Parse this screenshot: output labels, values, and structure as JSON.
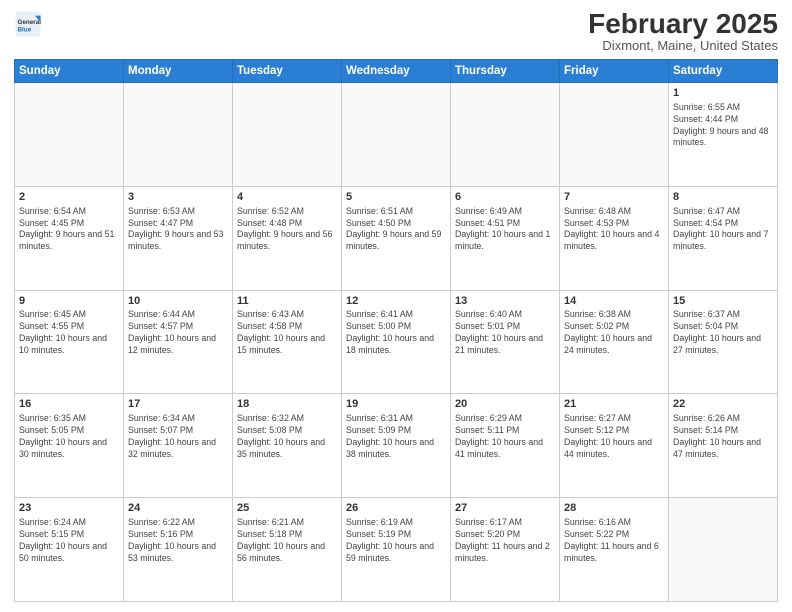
{
  "header": {
    "logo": {
      "general": "General",
      "blue": "Blue"
    },
    "title": "February 2025",
    "location": "Dixmont, Maine, United States"
  },
  "days_of_week": [
    "Sunday",
    "Monday",
    "Tuesday",
    "Wednesday",
    "Thursday",
    "Friday",
    "Saturday"
  ],
  "weeks": [
    [
      {
        "day": "",
        "info": ""
      },
      {
        "day": "",
        "info": ""
      },
      {
        "day": "",
        "info": ""
      },
      {
        "day": "",
        "info": ""
      },
      {
        "day": "",
        "info": ""
      },
      {
        "day": "",
        "info": ""
      },
      {
        "day": "1",
        "info": "Sunrise: 6:55 AM\nSunset: 4:44 PM\nDaylight: 9 hours and 48 minutes."
      }
    ],
    [
      {
        "day": "2",
        "info": "Sunrise: 6:54 AM\nSunset: 4:45 PM\nDaylight: 9 hours and 51 minutes."
      },
      {
        "day": "3",
        "info": "Sunrise: 6:53 AM\nSunset: 4:47 PM\nDaylight: 9 hours and 53 minutes."
      },
      {
        "day": "4",
        "info": "Sunrise: 6:52 AM\nSunset: 4:48 PM\nDaylight: 9 hours and 56 minutes."
      },
      {
        "day": "5",
        "info": "Sunrise: 6:51 AM\nSunset: 4:50 PM\nDaylight: 9 hours and 59 minutes."
      },
      {
        "day": "6",
        "info": "Sunrise: 6:49 AM\nSunset: 4:51 PM\nDaylight: 10 hours and 1 minute."
      },
      {
        "day": "7",
        "info": "Sunrise: 6:48 AM\nSunset: 4:53 PM\nDaylight: 10 hours and 4 minutes."
      },
      {
        "day": "8",
        "info": "Sunrise: 6:47 AM\nSunset: 4:54 PM\nDaylight: 10 hours and 7 minutes."
      }
    ],
    [
      {
        "day": "9",
        "info": "Sunrise: 6:45 AM\nSunset: 4:55 PM\nDaylight: 10 hours and 10 minutes."
      },
      {
        "day": "10",
        "info": "Sunrise: 6:44 AM\nSunset: 4:57 PM\nDaylight: 10 hours and 12 minutes."
      },
      {
        "day": "11",
        "info": "Sunrise: 6:43 AM\nSunset: 4:58 PM\nDaylight: 10 hours and 15 minutes."
      },
      {
        "day": "12",
        "info": "Sunrise: 6:41 AM\nSunset: 5:00 PM\nDaylight: 10 hours and 18 minutes."
      },
      {
        "day": "13",
        "info": "Sunrise: 6:40 AM\nSunset: 5:01 PM\nDaylight: 10 hours and 21 minutes."
      },
      {
        "day": "14",
        "info": "Sunrise: 6:38 AM\nSunset: 5:02 PM\nDaylight: 10 hours and 24 minutes."
      },
      {
        "day": "15",
        "info": "Sunrise: 6:37 AM\nSunset: 5:04 PM\nDaylight: 10 hours and 27 minutes."
      }
    ],
    [
      {
        "day": "16",
        "info": "Sunrise: 6:35 AM\nSunset: 5:05 PM\nDaylight: 10 hours and 30 minutes."
      },
      {
        "day": "17",
        "info": "Sunrise: 6:34 AM\nSunset: 5:07 PM\nDaylight: 10 hours and 32 minutes."
      },
      {
        "day": "18",
        "info": "Sunrise: 6:32 AM\nSunset: 5:08 PM\nDaylight: 10 hours and 35 minutes."
      },
      {
        "day": "19",
        "info": "Sunrise: 6:31 AM\nSunset: 5:09 PM\nDaylight: 10 hours and 38 minutes."
      },
      {
        "day": "20",
        "info": "Sunrise: 6:29 AM\nSunset: 5:11 PM\nDaylight: 10 hours and 41 minutes."
      },
      {
        "day": "21",
        "info": "Sunrise: 6:27 AM\nSunset: 5:12 PM\nDaylight: 10 hours and 44 minutes."
      },
      {
        "day": "22",
        "info": "Sunrise: 6:26 AM\nSunset: 5:14 PM\nDaylight: 10 hours and 47 minutes."
      }
    ],
    [
      {
        "day": "23",
        "info": "Sunrise: 6:24 AM\nSunset: 5:15 PM\nDaylight: 10 hours and 50 minutes."
      },
      {
        "day": "24",
        "info": "Sunrise: 6:22 AM\nSunset: 5:16 PM\nDaylight: 10 hours and 53 minutes."
      },
      {
        "day": "25",
        "info": "Sunrise: 6:21 AM\nSunset: 5:18 PM\nDaylight: 10 hours and 56 minutes."
      },
      {
        "day": "26",
        "info": "Sunrise: 6:19 AM\nSunset: 5:19 PM\nDaylight: 10 hours and 59 minutes."
      },
      {
        "day": "27",
        "info": "Sunrise: 6:17 AM\nSunset: 5:20 PM\nDaylight: 11 hours and 2 minutes."
      },
      {
        "day": "28",
        "info": "Sunrise: 6:16 AM\nSunset: 5:22 PM\nDaylight: 11 hours and 6 minutes."
      },
      {
        "day": "",
        "info": ""
      }
    ]
  ]
}
